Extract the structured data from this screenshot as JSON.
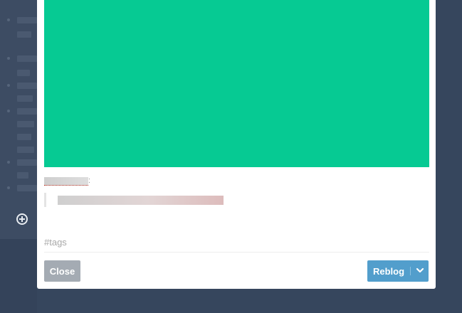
{
  "modal": {
    "tags_placeholder": "#tags",
    "close_label": "Close",
    "reblog_label": "Reblog",
    "caption_separator": ":"
  },
  "colors": {
    "photo": "#06ca93",
    "reblog": "#529ecc",
    "close": "#a4abb3",
    "backdrop": "#36465d"
  },
  "icons": {
    "compose": "plus-circle-icon",
    "dropdown": "chevron-down-icon"
  }
}
